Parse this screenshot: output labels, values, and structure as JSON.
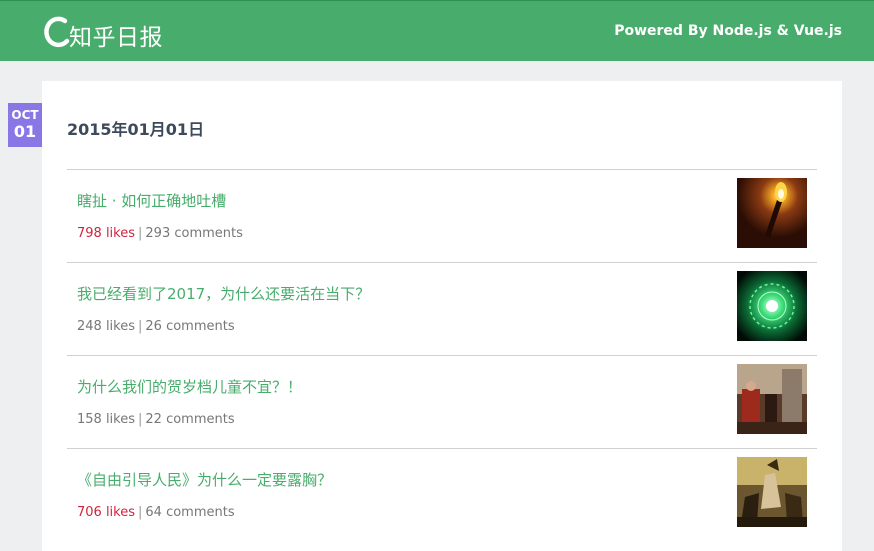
{
  "header": {
    "logo_text": "知乎日报",
    "powered": "Powered By Node.js & Vue.js",
    "bg_color": "#48ad6c"
  },
  "date_badge": {
    "month": "OCT",
    "day": "01",
    "color": "#8a77e6"
  },
  "day_title": "2015年01月01日",
  "stories": [
    {
      "title": "瞎扯 · 如何正确地吐槽",
      "likes": "798 likes",
      "comments": "293 comments",
      "hot": true,
      "thumb_icon": "torch-image"
    },
    {
      "title": "我已经看到了2017，为什么还要活在当下？",
      "likes": "248 likes",
      "comments": "26 comments",
      "hot": false,
      "thumb_icon": "green-orb-image"
    },
    {
      "title": "为什么我们的贺岁档儿童不宜？！",
      "likes": "158 likes",
      "comments": "22 comments",
      "hot": false,
      "thumb_icon": "movie-scene-image"
    },
    {
      "title": "《自由引导人民》为什么一定要露胸？",
      "likes": "706 likes",
      "comments": "64 comments",
      "hot": true,
      "thumb_icon": "painting-image"
    }
  ]
}
